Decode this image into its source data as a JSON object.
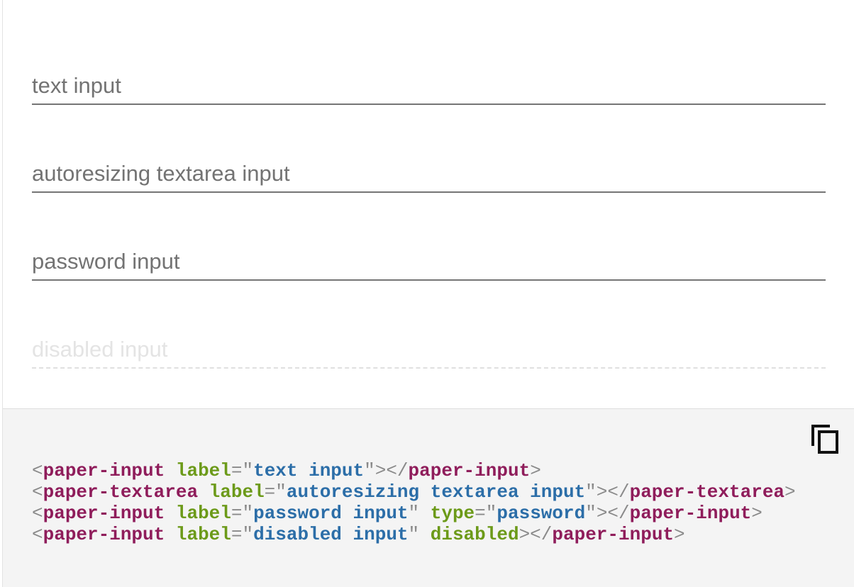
{
  "inputs": {
    "text": {
      "label": "text input"
    },
    "textarea": {
      "label": "autoresizing textarea input"
    },
    "password": {
      "label": "password input"
    },
    "disabled": {
      "label": "disabled input"
    }
  },
  "code_panel": {
    "copy_icon": "copy-icon",
    "lines": [
      [
        {
          "t": "<",
          "k": "punc"
        },
        {
          "t": "paper-input",
          "k": "tag"
        },
        {
          "t": " ",
          "k": "punc"
        },
        {
          "t": "label",
          "k": "attr"
        },
        {
          "t": "=\"",
          "k": "punc"
        },
        {
          "t": "text input",
          "k": "val"
        },
        {
          "t": "\"></",
          "k": "punc"
        },
        {
          "t": "paper-input",
          "k": "tag"
        },
        {
          "t": ">",
          "k": "punc"
        }
      ],
      [
        {
          "t": "<",
          "k": "punc"
        },
        {
          "t": "paper-textarea",
          "k": "tag"
        },
        {
          "t": " ",
          "k": "punc"
        },
        {
          "t": "label",
          "k": "attr"
        },
        {
          "t": "=\"",
          "k": "punc"
        },
        {
          "t": "autoresizing textarea input",
          "k": "val"
        },
        {
          "t": "\"></",
          "k": "punc"
        },
        {
          "t": "paper-textarea",
          "k": "tag"
        },
        {
          "t": ">",
          "k": "punc"
        }
      ],
      [
        {
          "t": "<",
          "k": "punc"
        },
        {
          "t": "paper-input",
          "k": "tag"
        },
        {
          "t": " ",
          "k": "punc"
        },
        {
          "t": "label",
          "k": "attr"
        },
        {
          "t": "=\"",
          "k": "punc"
        },
        {
          "t": "password input",
          "k": "val"
        },
        {
          "t": "\" ",
          "k": "punc"
        },
        {
          "t": "type",
          "k": "attr"
        },
        {
          "t": "=\"",
          "k": "punc"
        },
        {
          "t": "password",
          "k": "val"
        },
        {
          "t": "\"></",
          "k": "punc"
        },
        {
          "t": "paper-input",
          "k": "tag"
        },
        {
          "t": ">",
          "k": "punc"
        }
      ],
      [
        {
          "t": "<",
          "k": "punc"
        },
        {
          "t": "paper-input",
          "k": "tag"
        },
        {
          "t": " ",
          "k": "punc"
        },
        {
          "t": "label",
          "k": "attr"
        },
        {
          "t": "=\"",
          "k": "punc"
        },
        {
          "t": "disabled input",
          "k": "val"
        },
        {
          "t": "\" ",
          "k": "punc"
        },
        {
          "t": "disabled",
          "k": "attr"
        },
        {
          "t": "></",
          "k": "punc"
        },
        {
          "t": "paper-input",
          "k": "tag"
        },
        {
          "t": ">",
          "k": "punc"
        }
      ]
    ]
  },
  "colors": {
    "tag": "#8f1d5b",
    "attribute": "#6c9a19",
    "value": "#2c6ea8",
    "punctuation": "#8a8a8a",
    "code_background": "#f4f4f4"
  }
}
